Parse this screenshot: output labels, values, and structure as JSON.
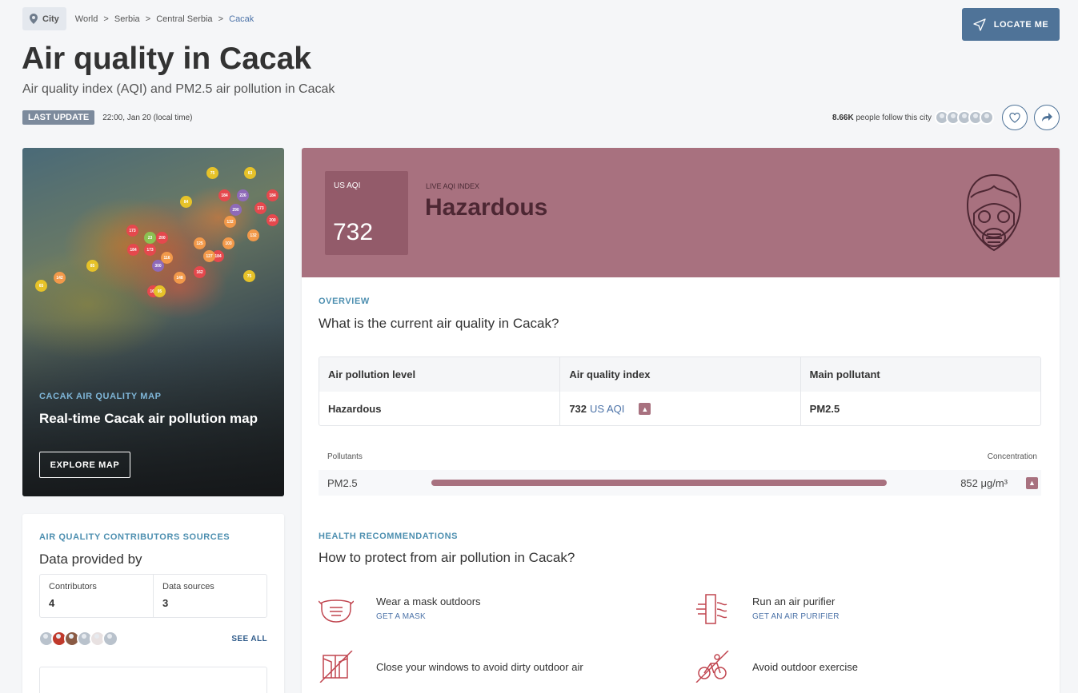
{
  "breadcrumb": {
    "chip_label": "City",
    "trail": [
      "World",
      ">",
      "Serbia",
      ">",
      "Central Serbia",
      ">"
    ],
    "current": "Cacak"
  },
  "locate_button": "LOCATE ME",
  "page": {
    "title": "Air quality in Cacak",
    "subtitle": "Air quality index (AQI) and PM2.5 air pollution in Cacak",
    "last_update_tag": "LAST UPDATE",
    "last_update_time": "22:00, Jan 20 (local time)",
    "followers_count": "8.66K",
    "followers_text": "people follow this city"
  },
  "map_card": {
    "kicker": "CACAK AIR QUALITY MAP",
    "title": "Real-time Cacak air pollution map",
    "button": "EXPLORE MAP",
    "markers": [
      "75",
      "63",
      "184",
      "226",
      "184",
      "84",
      "290",
      "173",
      "200",
      "132",
      "173",
      "23",
      "200",
      "125",
      "103",
      "132",
      "184",
      "173",
      "184",
      "300",
      "127",
      "116",
      "85",
      "142",
      "148",
      "162",
      "75",
      "65",
      "167",
      "95"
    ]
  },
  "contributors": {
    "kicker": "AIR QUALITY CONTRIBUTORS SOURCES",
    "title": "Data provided by",
    "contributors_label": "Contributors",
    "contributors_value": "4",
    "sources_label": "Data sources",
    "sources_value": "3",
    "see_all": "SEE ALL"
  },
  "aqi": {
    "label": "US AQI",
    "value": "732",
    "live_label": "LIVE AQI INDEX",
    "status": "Hazardous",
    "color": "#a8717f"
  },
  "overview": {
    "kicker": "OVERVIEW",
    "question": "What is the current air quality in Cacak?",
    "headers": [
      "Air pollution level",
      "Air quality index",
      "Main pollutant"
    ],
    "level": "Hazardous",
    "index_value": "732",
    "index_unit": "US AQI",
    "main_pollutant": "PM2.5"
  },
  "pollutants": {
    "header_left": "Pollutants",
    "header_right": "Concentration",
    "items": [
      {
        "name": "PM2.5",
        "value": "852 μg/m³",
        "level": 1.0
      }
    ]
  },
  "health": {
    "kicker": "HEALTH RECOMMENDATIONS",
    "question": "How to protect from air pollution in Cacak?",
    "items": [
      {
        "title": "Wear a mask outdoors",
        "link": "GET A MASK",
        "icon": "mask-icon"
      },
      {
        "title": "Run an air purifier",
        "link": "GET AN AIR PURIFIER",
        "icon": "air-purifier-icon"
      },
      {
        "title": "Close your windows to avoid dirty outdoor air",
        "link": "",
        "icon": "closed-window-icon"
      },
      {
        "title": "Avoid outdoor exercise",
        "link": "",
        "icon": "no-cycling-icon"
      }
    ]
  }
}
